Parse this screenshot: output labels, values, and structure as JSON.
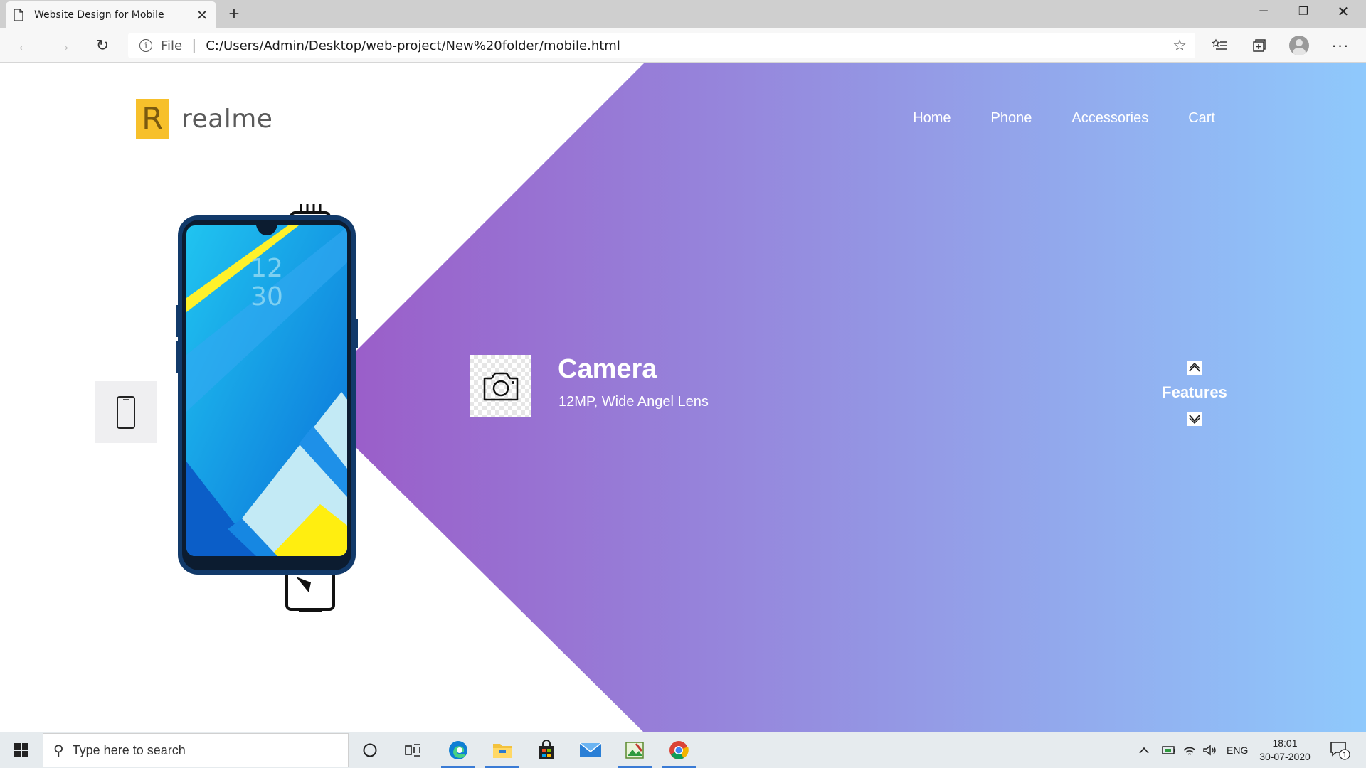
{
  "browser": {
    "tab_title": "Website Design for Mobile",
    "url_scheme": "File",
    "url": "C:/Users/Admin/Desktop/web-project/New%20folder/mobile.html"
  },
  "page": {
    "logo_text": "realme",
    "logo_letter": "R",
    "nav": [
      "Home",
      "Phone",
      "Accessories",
      "Cart"
    ],
    "feature": {
      "title": "Camera",
      "subtitle": "12MP, Wide Angel Lens",
      "icon": "camera-icon"
    },
    "features_label": "Features",
    "phone_screen": {
      "hour": "12",
      "minute": "30"
    },
    "colors": {
      "gradient_start": "#9a5ec9",
      "gradient_end": "#8fc9fc",
      "logo_yellow": "#f7c02b"
    }
  },
  "taskbar": {
    "search_placeholder": "Type here to search",
    "language": "ENG",
    "time": "18:01",
    "date": "30-07-2020",
    "notification_count": "1"
  }
}
